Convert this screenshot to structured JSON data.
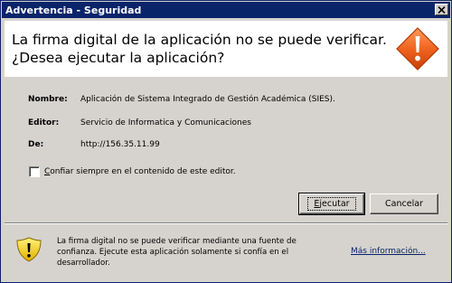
{
  "window": {
    "title": "Advertencia - Seguridad",
    "close_glyph": "✕"
  },
  "header": {
    "line1": "La firma digital de la aplicación no se puede verificar.",
    "line2": "¿Desea ejecutar la aplicación?",
    "icon": "warning-diamond-icon",
    "icon_glyph": "!"
  },
  "details": {
    "name_label": "Nombre:",
    "name_value": "Aplicación de Sistema Integrado de Gestión Académica  (SIES).",
    "publisher_label": "Editor:",
    "publisher_value": "Servicio de Informatica y Comunicaciones",
    "from_label": "De:",
    "from_value": "http://156.35.11.99"
  },
  "trust_checkbox": {
    "label_first": "C",
    "label_rest": "onfiar siempre en el contenido de este editor.",
    "checked": false
  },
  "buttons": {
    "run_first": "E",
    "run_rest": "jecutar",
    "cancel": "Cancelar"
  },
  "footer": {
    "icon": "warning-shield-icon",
    "icon_glyph": "!",
    "message": "La firma digital no se puede verificar mediante una fuente de confianza.  Ejecute esta aplicación solamente si confía en el desarrollador.",
    "more_first": "M",
    "more_rest": "ás información..."
  },
  "colors": {
    "titlebar": "#0a246a",
    "dialog_bg": "#d6d3ce",
    "warning_orange": "#f0641e",
    "shield_yellow": "#f2d21b"
  }
}
